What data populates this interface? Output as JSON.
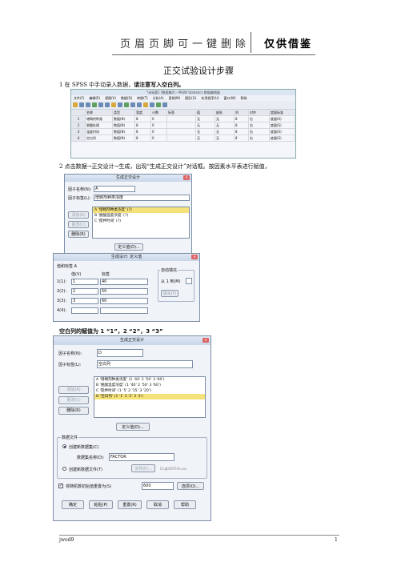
{
  "header": {
    "title": "页眉页脚可一键删除",
    "right": "仅供借鉴"
  },
  "doc_title": "正交试验设计步骤",
  "step1": {
    "text": "1 在 SPSS 中手动录入数据，",
    "emph": "请注意写入空白列。"
  },
  "step2": "2 点击数据→正交设计→生成，出现“生成正交设计”对话框。按因素水平表进行赋值，",
  "note": "空白列的赋值为 1 “1”，2 “2”，3 “3”",
  "spss": {
    "title": "*未标题1 [数据集0] - PASW Statistics 数据编辑器",
    "menu": [
      "文件(F)",
      "编辑(E)",
      "视图(V)",
      "数据(D)",
      "转换(T)",
      "分析(A)",
      "直销(M)",
      "图形(G)",
      "实用程序(U)",
      "窗口(W)",
      "帮助"
    ],
    "columns": [
      "",
      "名称",
      "类型",
      "宽度",
      "小数",
      "标签",
      "值",
      "缺失",
      "列",
      "对齐",
      "度量标准"
    ],
    "rows": [
      [
        "1",
        "增稠剂种类",
        "数值(N)",
        "8",
        "0",
        "",
        "无",
        "无",
        "8",
        "右",
        "度量(S)"
      ],
      [
        "2",
        "脱酸处理",
        "数值(N)",
        "8",
        "0",
        "",
        "无",
        "无",
        "8",
        "右",
        "度量(S)"
      ],
      [
        "3",
        "温度时间",
        "数值(N)",
        "8",
        "0",
        "",
        "无",
        "无",
        "8",
        "右",
        "度量(S)"
      ],
      [
        "4",
        "空白列",
        "数值(N)",
        "8",
        "0",
        "",
        "无",
        "无",
        "8",
        "右",
        "度量(S)"
      ]
    ]
  },
  "dlg1": {
    "title": "生成正交设计",
    "factor_name_label": "因子名称(N):",
    "factor_name": "A",
    "factor_label_label": "因子标签(L):",
    "factor_label": "增稠剂种类浓度",
    "buttons": [
      "添加(A)",
      "更改(C)",
      "删除(R)"
    ],
    "list": [
      "A '增稠剂种类浓度' (?)",
      "B '脱酸温度浓度' (?)",
      "C '搅拌时间' (?)"
    ],
    "define": "定义值(D)..."
  },
  "dlg2": {
    "title": "生成设计: 定义值",
    "subtitle": "值和标签 A",
    "col_value": "值(V)",
    "col_label": "标签",
    "rows": [
      {
        "n": "1(1):",
        "v": "1",
        "l": "40"
      },
      {
        "n": "2(2):",
        "v": "2",
        "l": "50"
      },
      {
        "n": "3(3):",
        "v": "3",
        "l": "60"
      },
      {
        "n": "4(4):",
        "v": "",
        "l": ""
      }
    ],
    "autofill": "自动填充",
    "autofill_from": "从 1 到(M)",
    "fill_btn": "填充(F)"
  },
  "dlg3": {
    "title": "生成正交设计",
    "factor_name_label": "因子名称(N):",
    "factor_name": "D",
    "factor_label_label": "因子标签(L):",
    "factor_label": "空白列",
    "buttons": [
      "添加(A)",
      "更改(C)",
      "删除(R)"
    ],
    "list": [
      "A '增稠剂种类浓度' (1 '40' 2 '50' 3 '60')",
      "B '脱酸温度浓度' (1 '40' 2 '50' 3 '60')",
      "C '搅拌时间' (1 '5' 2 '15' 3 '20')",
      "D '空白列' (1 '1' 2 '2' 3 '3')"
    ],
    "define": "定义值(D)...",
    "data_file": "数据文件",
    "radio1": "创建新数据集(C)",
    "dataset_label": "数据集名称(D):",
    "dataset_value": "FACTOR",
    "radio2": "创建新数据文件(T)",
    "file_btn": "文件(F)...",
    "file_path": "D:\\桌\\ORTHO.sav",
    "seed_label": "将随机数初始值重置为(S)",
    "seed_value": "600",
    "options": "选项(O)...",
    "bottom": [
      "确定",
      "粘贴(P)",
      "重置(R)",
      "取消",
      "帮助"
    ]
  },
  "footer": {
    "left": "jwod9",
    "right": "1"
  }
}
